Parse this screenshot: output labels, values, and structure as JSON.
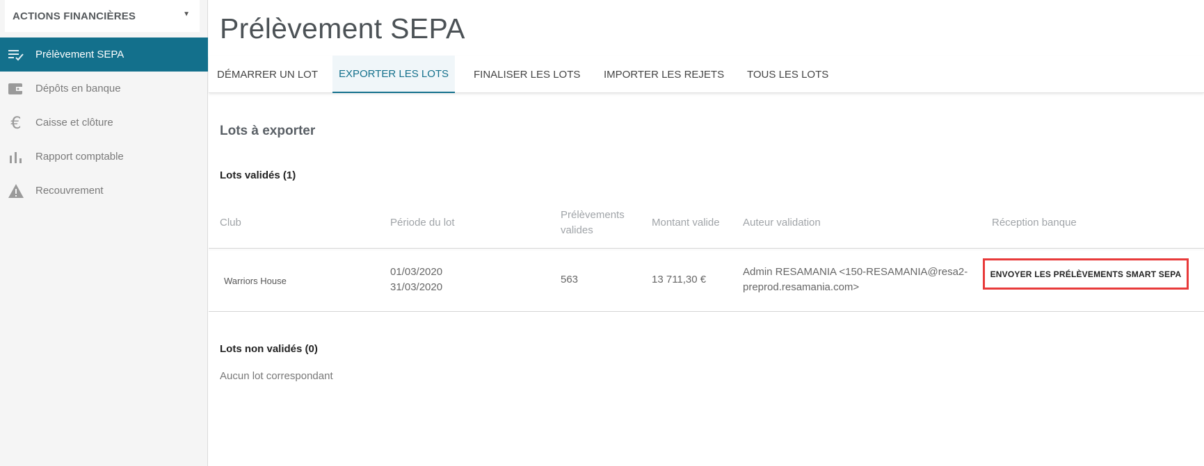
{
  "sidebar": {
    "module_label": "ACTIONS FINANCIÈRES",
    "items": [
      {
        "label": "Prélèvement SEPA",
        "icon": "list-check-icon",
        "active": true
      },
      {
        "label": "Dépôts en banque",
        "icon": "wallet-icon",
        "active": false
      },
      {
        "label": "Caisse et clôture",
        "icon": "euro-icon",
        "active": false
      },
      {
        "label": "Rapport comptable",
        "icon": "bar-chart-icon",
        "active": false
      },
      {
        "label": "Recouvrement",
        "icon": "warning-icon",
        "active": false
      }
    ]
  },
  "page": {
    "title": "Prélèvement SEPA",
    "tabs": [
      {
        "label": "DÉMARRER UN LOT",
        "active": false
      },
      {
        "label": "EXPORTER LES LOTS",
        "active": true
      },
      {
        "label": "FINALISER LES LOTS",
        "active": false
      },
      {
        "label": "IMPORTER LES REJETS",
        "active": false
      },
      {
        "label": "TOUS LES LOTS",
        "active": false
      }
    ],
    "section_title": "Lots à exporter",
    "validated_title": "Lots validés (1)",
    "columns": {
      "club": "Club",
      "periode": "Période du lot",
      "prelevements_line1": "Prélèvements",
      "prelevements_line2": "valides",
      "montant": "Montant valide",
      "auteur": "Auteur validation",
      "reception": "Réception banque"
    },
    "rows": [
      {
        "club": "Warriors House",
        "periode_debut": "01/03/2020",
        "periode_fin": "31/03/2020",
        "prelevements": "563",
        "montant": "13 711,30 €",
        "auteur_line1": "Admin RESAMANIA <150-RESAMANIA@resa2-",
        "auteur_line2": "preprod.resamania.com>",
        "action_label": "ENVOYER LES PRÉLÈVEMENTS SMART SEPA"
      }
    ],
    "not_validated_title": "Lots non validés (0)",
    "empty_text": "Aucun lot correspondant"
  },
  "colors": {
    "accent": "#13708c",
    "highlight": "#e83a3a"
  }
}
